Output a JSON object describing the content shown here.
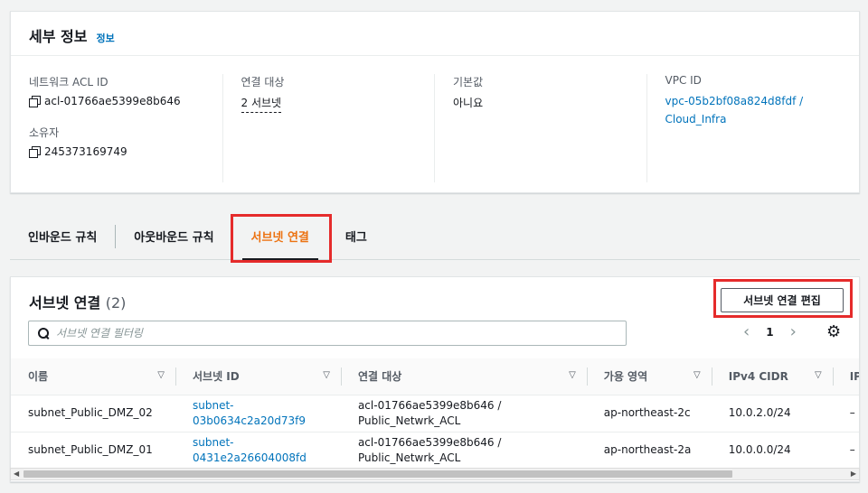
{
  "details": {
    "title": "세부 정보",
    "info": "정보",
    "acl_id_label": "네트워크 ACL ID",
    "acl_id": "acl-01766ae5399e8b646",
    "owner_label": "소유자",
    "owner": "245373169749",
    "associated_label": "연결 대상",
    "associated": "2 서브넷",
    "default_label": "기본값",
    "default": "아니요",
    "vpc_label": "VPC ID",
    "vpc_line1": "vpc-05b2bf08a824d8fdf /",
    "vpc_line2": "Cloud_Infra"
  },
  "tabs": [
    {
      "label": "인바운드 규칙"
    },
    {
      "label": "아웃바운드 규칙"
    },
    {
      "label": "서브넷 연결"
    },
    {
      "label": "태그"
    }
  ],
  "active_tab": "서브넷 연결",
  "subnets": {
    "title": "서브넷 연결",
    "count": "(2)",
    "edit_button": "서브넷 연결 편집",
    "search_placeholder": "서브넷 연결 필터링",
    "page": "1",
    "columns": [
      "이름",
      "서브넷 ID",
      "연결 대상",
      "가용 영역",
      "IPv4 CIDR",
      "IP"
    ],
    "rows": [
      {
        "name": "subnet_Public_DMZ_02",
        "id1": "subnet-",
        "id2": "03b0634c2a20d73f9",
        "assoc1": "acl-01766ae5399e8b646 /",
        "assoc2": "Public_Netwrk_ACL",
        "az": "ap-northeast-2c",
        "cidr": "10.0.2.0/24",
        "ip": "–"
      },
      {
        "name": "subnet_Public_DMZ_01",
        "id1": "subnet-",
        "id2": "0431e2a26604008fd",
        "assoc1": "acl-01766ae5399e8b646 /",
        "assoc2": "Public_Netwrk_ACL",
        "az": "ap-northeast-2a",
        "cidr": "10.0.0.0/24",
        "ip": "–"
      }
    ]
  },
  "colors": {
    "link": "#0073bb",
    "active_tab": "#ec7211",
    "highlight": "#e52b2b"
  }
}
